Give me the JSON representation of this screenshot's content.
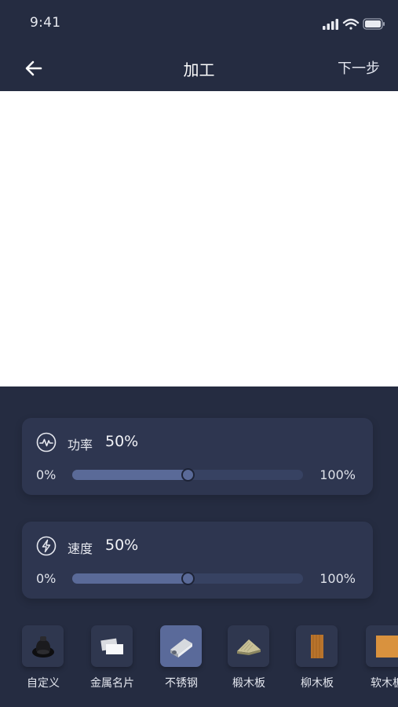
{
  "status_bar": {
    "time": "9:41"
  },
  "nav": {
    "title": "加工",
    "next_label": "下一步"
  },
  "power": {
    "label": "功率",
    "value_text": "50%",
    "value": 0.5,
    "min_label": "0%",
    "max_label": "100%"
  },
  "speed": {
    "label": "速度",
    "value_text": "50%",
    "value": 0.5,
    "min_label": "0%",
    "max_label": "100%"
  },
  "materials": [
    {
      "label": "自定义",
      "icon": "custom-material-icon",
      "selected": false
    },
    {
      "label": "金属名片",
      "icon": "metal-card-icon",
      "selected": false
    },
    {
      "label": "不锈钢",
      "icon": "stainless-steel-icon",
      "selected": true
    },
    {
      "label": "椴木板",
      "icon": "basswood-board-icon",
      "selected": false
    },
    {
      "label": "柳木板",
      "icon": "willow-board-icon",
      "selected": false
    },
    {
      "label": "软木板",
      "icon": "cork-board-icon",
      "selected": false
    }
  ],
  "colors": {
    "background": "#252c41",
    "panel": "#2e3650",
    "accent": "#5a6a98",
    "canvas": "#ffffff"
  }
}
